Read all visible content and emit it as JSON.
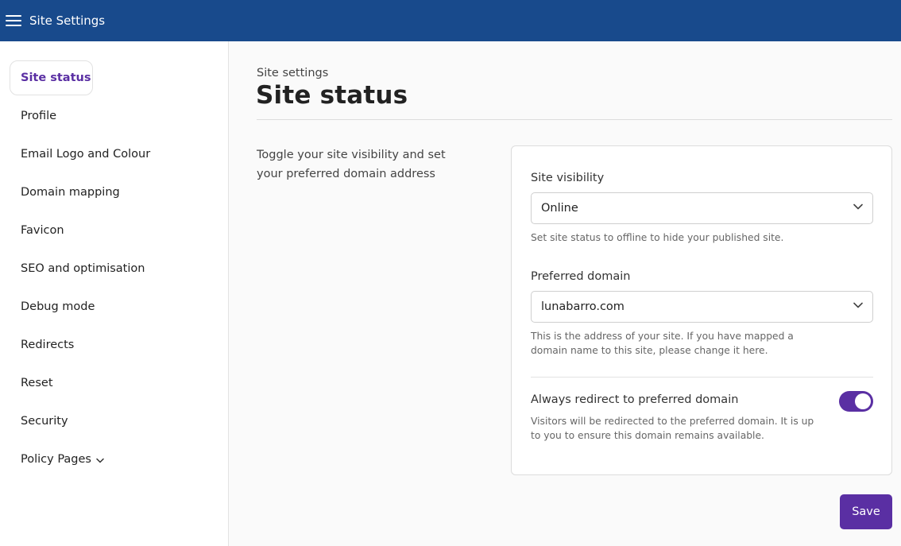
{
  "header": {
    "title": "Site Settings",
    "menu_icon": "hamburger-icon",
    "background": "#184a8c"
  },
  "sidebar": {
    "items": [
      {
        "label": "Site status",
        "active": true
      },
      {
        "label": "Profile"
      },
      {
        "label": "Email Logo and Colour"
      },
      {
        "label": "Domain mapping"
      },
      {
        "label": "Favicon"
      },
      {
        "label": "SEO and optimisation"
      },
      {
        "label": "Debug mode"
      },
      {
        "label": "Redirects"
      },
      {
        "label": "Reset"
      },
      {
        "label": "Security"
      },
      {
        "label": "Policy Pages",
        "icon": "chevron-down-icon"
      }
    ]
  },
  "main": {
    "breadcrumb": "Site settings",
    "title": "Site status",
    "description": "Toggle your site visibility and set your preferred domain address",
    "visibility": {
      "label": "Site visibility",
      "value": "Online",
      "help": "Set site status to offline to hide your published site."
    },
    "domain": {
      "label": "Preferred domain",
      "value": "lunabarro.com",
      "help": "This is the address of your site. If you have mapped a domain name to this site, please change it here."
    },
    "redirect": {
      "label": "Always redirect to preferred domain",
      "help": "Visitors will be redirected to the preferred domain. It is up to you to ensure this domain remains available.",
      "enabled": true
    },
    "save_label": "Save"
  },
  "colors": {
    "accent": "#5a2fa3",
    "header": "#184a8c"
  }
}
